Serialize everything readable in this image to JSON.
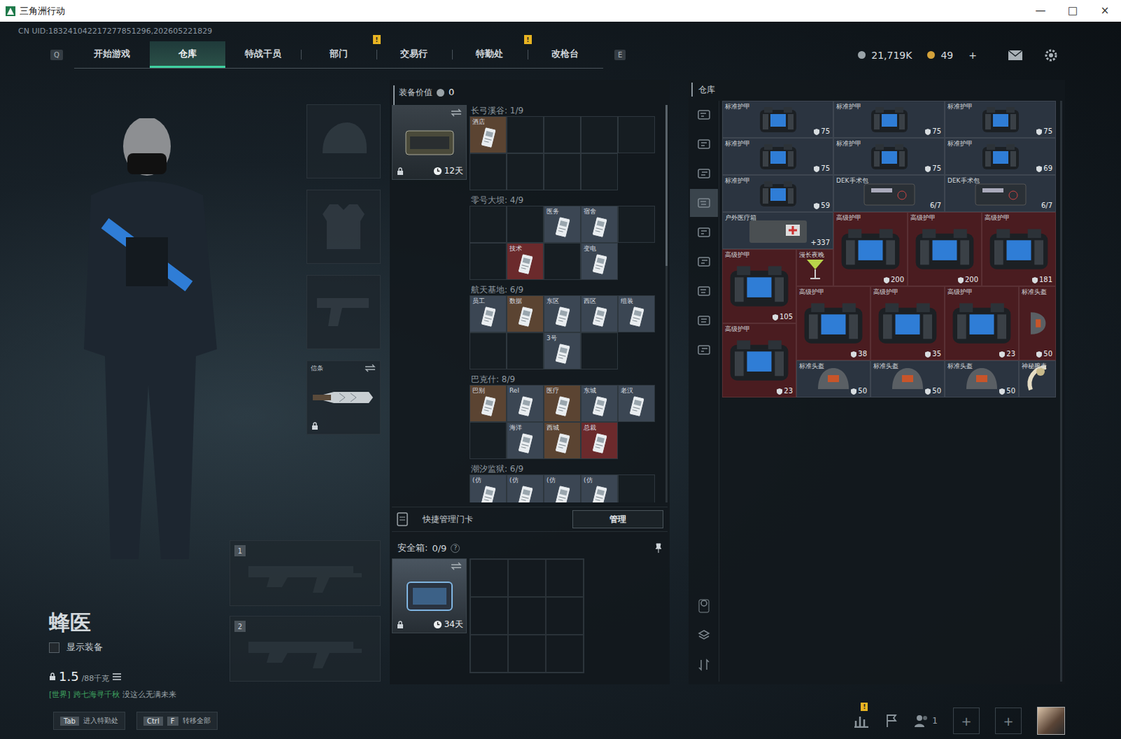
{
  "window": {
    "title": "三角洲行动",
    "controls": [
      "—",
      "□",
      "×"
    ]
  },
  "uid": "CN UID:183241042217277851296,202605221829",
  "nav": {
    "prev_key": "Q",
    "next_key": "E",
    "tabs": [
      {
        "label": "开始游戏",
        "selected": false,
        "badge": ""
      },
      {
        "label": "仓库",
        "selected": true,
        "badge": ""
      },
      {
        "label": "特战干员",
        "selected": false,
        "badge": ""
      },
      {
        "label": "部门",
        "selected": false,
        "badge": "!"
      },
      {
        "label": "交易行",
        "selected": false,
        "badge": ""
      },
      {
        "label": "特勤处",
        "selected": false,
        "badge": "!"
      },
      {
        "label": "改枪台",
        "selected": false,
        "badge": ""
      }
    ]
  },
  "currency": {
    "coins": "21,719K",
    "bonds": "49",
    "add": "+"
  },
  "operator": {
    "name": "蜂医",
    "show_gear": {
      "label": "显示装备",
      "checked": false
    },
    "weight": "1.5",
    "capacity": "/88千克",
    "chat": {
      "channel": "[世界]",
      "sender": "跨七海寻千秋",
      "message": "没这么无满未来"
    }
  },
  "gear_slots": [
    {
      "kind": "helmet",
      "filled": false,
      "label": "",
      "locked": false
    },
    {
      "kind": "armor",
      "filled": false,
      "label": "",
      "locked": false
    },
    {
      "kind": "pistol",
      "filled": false,
      "label": "",
      "locked": false
    },
    {
      "kind": "melee",
      "filled": true,
      "label": "信条",
      "locked": true
    }
  ],
  "weapon_slots": [
    {
      "number": "1",
      "filled": false
    },
    {
      "number": "2",
      "filled": false
    }
  ],
  "equipment_value": {
    "label": "装备价值",
    "value": "0"
  },
  "key_case": {
    "days": "12天",
    "locked": true
  },
  "maps": [
    {
      "title": "长弓溪谷: 1/9",
      "slots": [
        {
          "kind": "card",
          "label": "酒店",
          "color": "#5b4432"
        },
        {
          "kind": "empty"
        },
        {
          "kind": "empty"
        },
        {
          "kind": "empty"
        },
        {
          "kind": "empty"
        },
        {
          "kind": "empty"
        },
        {
          "kind": "empty"
        },
        {
          "kind": "empty"
        },
        {
          "kind": "empty"
        }
      ]
    },
    {
      "title": "零号大坝: 4/9",
      "slots": [
        {
          "kind": "empty"
        },
        {
          "kind": "empty"
        },
        {
          "kind": "card",
          "label": "医务",
          "color": "#3b4653"
        },
        {
          "kind": "card",
          "label": "宿舍",
          "color": "#3b4653"
        },
        {
          "kind": "empty"
        },
        {
          "kind": "empty"
        },
        {
          "kind": "card",
          "label": "技术",
          "color": "#6b2a2c"
        },
        {
          "kind": "empty"
        },
        {
          "kind": "card",
          "label": "变电",
          "color": "#3b4653"
        }
      ]
    },
    {
      "title": "航天基地: 6/9",
      "slots": [
        {
          "kind": "card",
          "label": "员工",
          "color": "#3b4653"
        },
        {
          "kind": "card",
          "label": "数据",
          "color": "#5b4432"
        },
        {
          "kind": "card",
          "label": "东区",
          "color": "#3b4653"
        },
        {
          "kind": "card",
          "label": "西区",
          "color": "#3b4653"
        },
        {
          "kind": "card",
          "label": "组装",
          "color": "#3b4653"
        },
        {
          "kind": "empty"
        },
        {
          "kind": "empty"
        },
        {
          "kind": "card",
          "label": "3号",
          "color": "#3b4653"
        },
        {
          "kind": "empty"
        }
      ]
    },
    {
      "title": "巴克什: 8/9",
      "slots": [
        {
          "kind": "card",
          "label": "巴别",
          "color": "#5b4432"
        },
        {
          "kind": "card",
          "label": "Rel",
          "color": "#3b4653"
        },
        {
          "kind": "card",
          "label": "医疗",
          "color": "#5b4432"
        },
        {
          "kind": "card",
          "label": "东城",
          "color": "#3b4653"
        },
        {
          "kind": "card",
          "label": "老汉",
          "color": "#3b4653"
        },
        {
          "kind": "empty"
        },
        {
          "kind": "card",
          "label": "海洋",
          "color": "#3b4653"
        },
        {
          "kind": "card",
          "label": "西城",
          "color": "#5b4432"
        },
        {
          "kind": "card",
          "label": "总裁",
          "color": "#6b2a2c"
        }
      ]
    },
    {
      "title": "潮汐监狱: 6/9",
      "slots": [
        {
          "kind": "card",
          "label": "(仿",
          "color": "#3b4653"
        },
        {
          "kind": "card",
          "label": "(仿",
          "color": "#3b4653"
        },
        {
          "kind": "card",
          "label": "(仿",
          "color": "#3b4653"
        },
        {
          "kind": "card",
          "label": "(仿",
          "color": "#3b4653"
        },
        {
          "kind": "empty"
        }
      ]
    }
  ],
  "quick_manage": {
    "label": "快捷管理门卡",
    "button": "管理"
  },
  "safe_box": {
    "label": "安全箱:",
    "count": "0/9",
    "help": "?",
    "days": "34天",
    "locked": true,
    "capacity": 9
  },
  "warehouse": {
    "title": "仓库",
    "side_tabs": [
      {
        "selected": false
      },
      {
        "selected": false
      },
      {
        "selected": false
      },
      {
        "selected": true
      },
      {
        "selected": false
      },
      {
        "selected": false
      },
      {
        "selected": false
      },
      {
        "selected": false
      },
      {
        "selected": false
      }
    ],
    "items": [
      {
        "kind": "standard-armor",
        "label": "标准护甲",
        "value": "75",
        "rotated": false,
        "color": "#2b3440"
      },
      {
        "kind": "standard-armor",
        "label": "标准护甲",
        "value": "75",
        "rotated": false,
        "color": "#2b3440"
      },
      {
        "kind": "standard-armor",
        "label": "标准护甲",
        "value": "75",
        "rotated": false,
        "color": "#2b3440"
      },
      {
        "kind": "standard-armor",
        "label": "标准护甲",
        "value": "75",
        "rotated": false,
        "color": "#2b3440"
      },
      {
        "kind": "standard-armor",
        "label": "标准护甲",
        "value": "75",
        "rotated": false,
        "color": "#2b3440"
      },
      {
        "kind": "standard-armor",
        "label": "标准护甲",
        "value": "69",
        "rotated": false,
        "color": "#2b3440"
      },
      {
        "kind": "standard-armor",
        "label": "标准护甲",
        "value": "59",
        "rotated": false,
        "color": "#2b3440"
      },
      {
        "kind": "surgery-kit",
        "label": "DEK手术包",
        "value": "6/7",
        "rotated": false,
        "color": "#2b3440"
      },
      {
        "kind": "surgery-kit",
        "label": "DEK手术包",
        "value": "6/7",
        "rotated": false,
        "color": "#2b3440"
      },
      {
        "kind": "med-box",
        "label": "户外医疗箱",
        "value": "+337",
        "rotated": false,
        "color": "#2b3440"
      },
      {
        "kind": "advanced-armor",
        "label": "高级护甲",
        "value": "200",
        "rotated": false,
        "color": "#4a1c20"
      },
      {
        "kind": "advanced-armor",
        "label": "高级护甲",
        "value": "200",
        "rotated": false,
        "color": "#4a1c20"
      },
      {
        "kind": "advanced-armor",
        "label": "高级护甲",
        "value": "181",
        "rotated": false,
        "color": "#4a1c20"
      },
      {
        "kind": "advanced-armor",
        "label": "高级护甲",
        "value": "105",
        "rotated": false,
        "color": "#4a1c20"
      },
      {
        "kind": "cocktail",
        "label": "漫长夜晚",
        "value": "",
        "rotated": false,
        "color": "#4a1c20"
      },
      {
        "kind": "advanced-armor",
        "label": "高级护甲",
        "value": "38",
        "rotated": false,
        "color": "#4a1c20"
      },
      {
        "kind": "advanced-armor",
        "label": "高级护甲",
        "value": "35",
        "rotated": false,
        "color": "#4a1c20"
      },
      {
        "kind": "advanced-armor",
        "label": "高级护甲",
        "value": "23",
        "rotated": false,
        "color": "#4a1c20"
      },
      {
        "kind": "helmet",
        "label": "标准头盔",
        "value": "50",
        "rotated": true,
        "color": "#4a1c20"
      },
      {
        "kind": "advanced-armor",
        "label": "高级护甲",
        "value": "23",
        "rotated": false,
        "color": "#4a1c20"
      },
      {
        "kind": "helmet",
        "label": "标准头盔",
        "value": "50",
        "rotated": false,
        "color": "#2b3440"
      },
      {
        "kind": "helmet",
        "label": "标准头盔",
        "value": "50",
        "rotated": false,
        "color": "#2b3440"
      },
      {
        "kind": "helmet",
        "label": "标准头盔",
        "value": "50",
        "rotated": false,
        "color": "#2b3440"
      },
      {
        "kind": "watch",
        "label": "神秘腕表",
        "value": "",
        "rotated": false,
        "color": "#2b3440"
      }
    ]
  },
  "bottom_bar": {
    "hints": [
      {
        "keys": [
          "Tab"
        ],
        "label": "进入特勤处"
      },
      {
        "keys": [
          "Ctrl",
          "F"
        ],
        "label": "转移全部"
      }
    ],
    "stats_badge": "!",
    "friends": "1",
    "add_slots": [
      "+",
      "+"
    ]
  }
}
